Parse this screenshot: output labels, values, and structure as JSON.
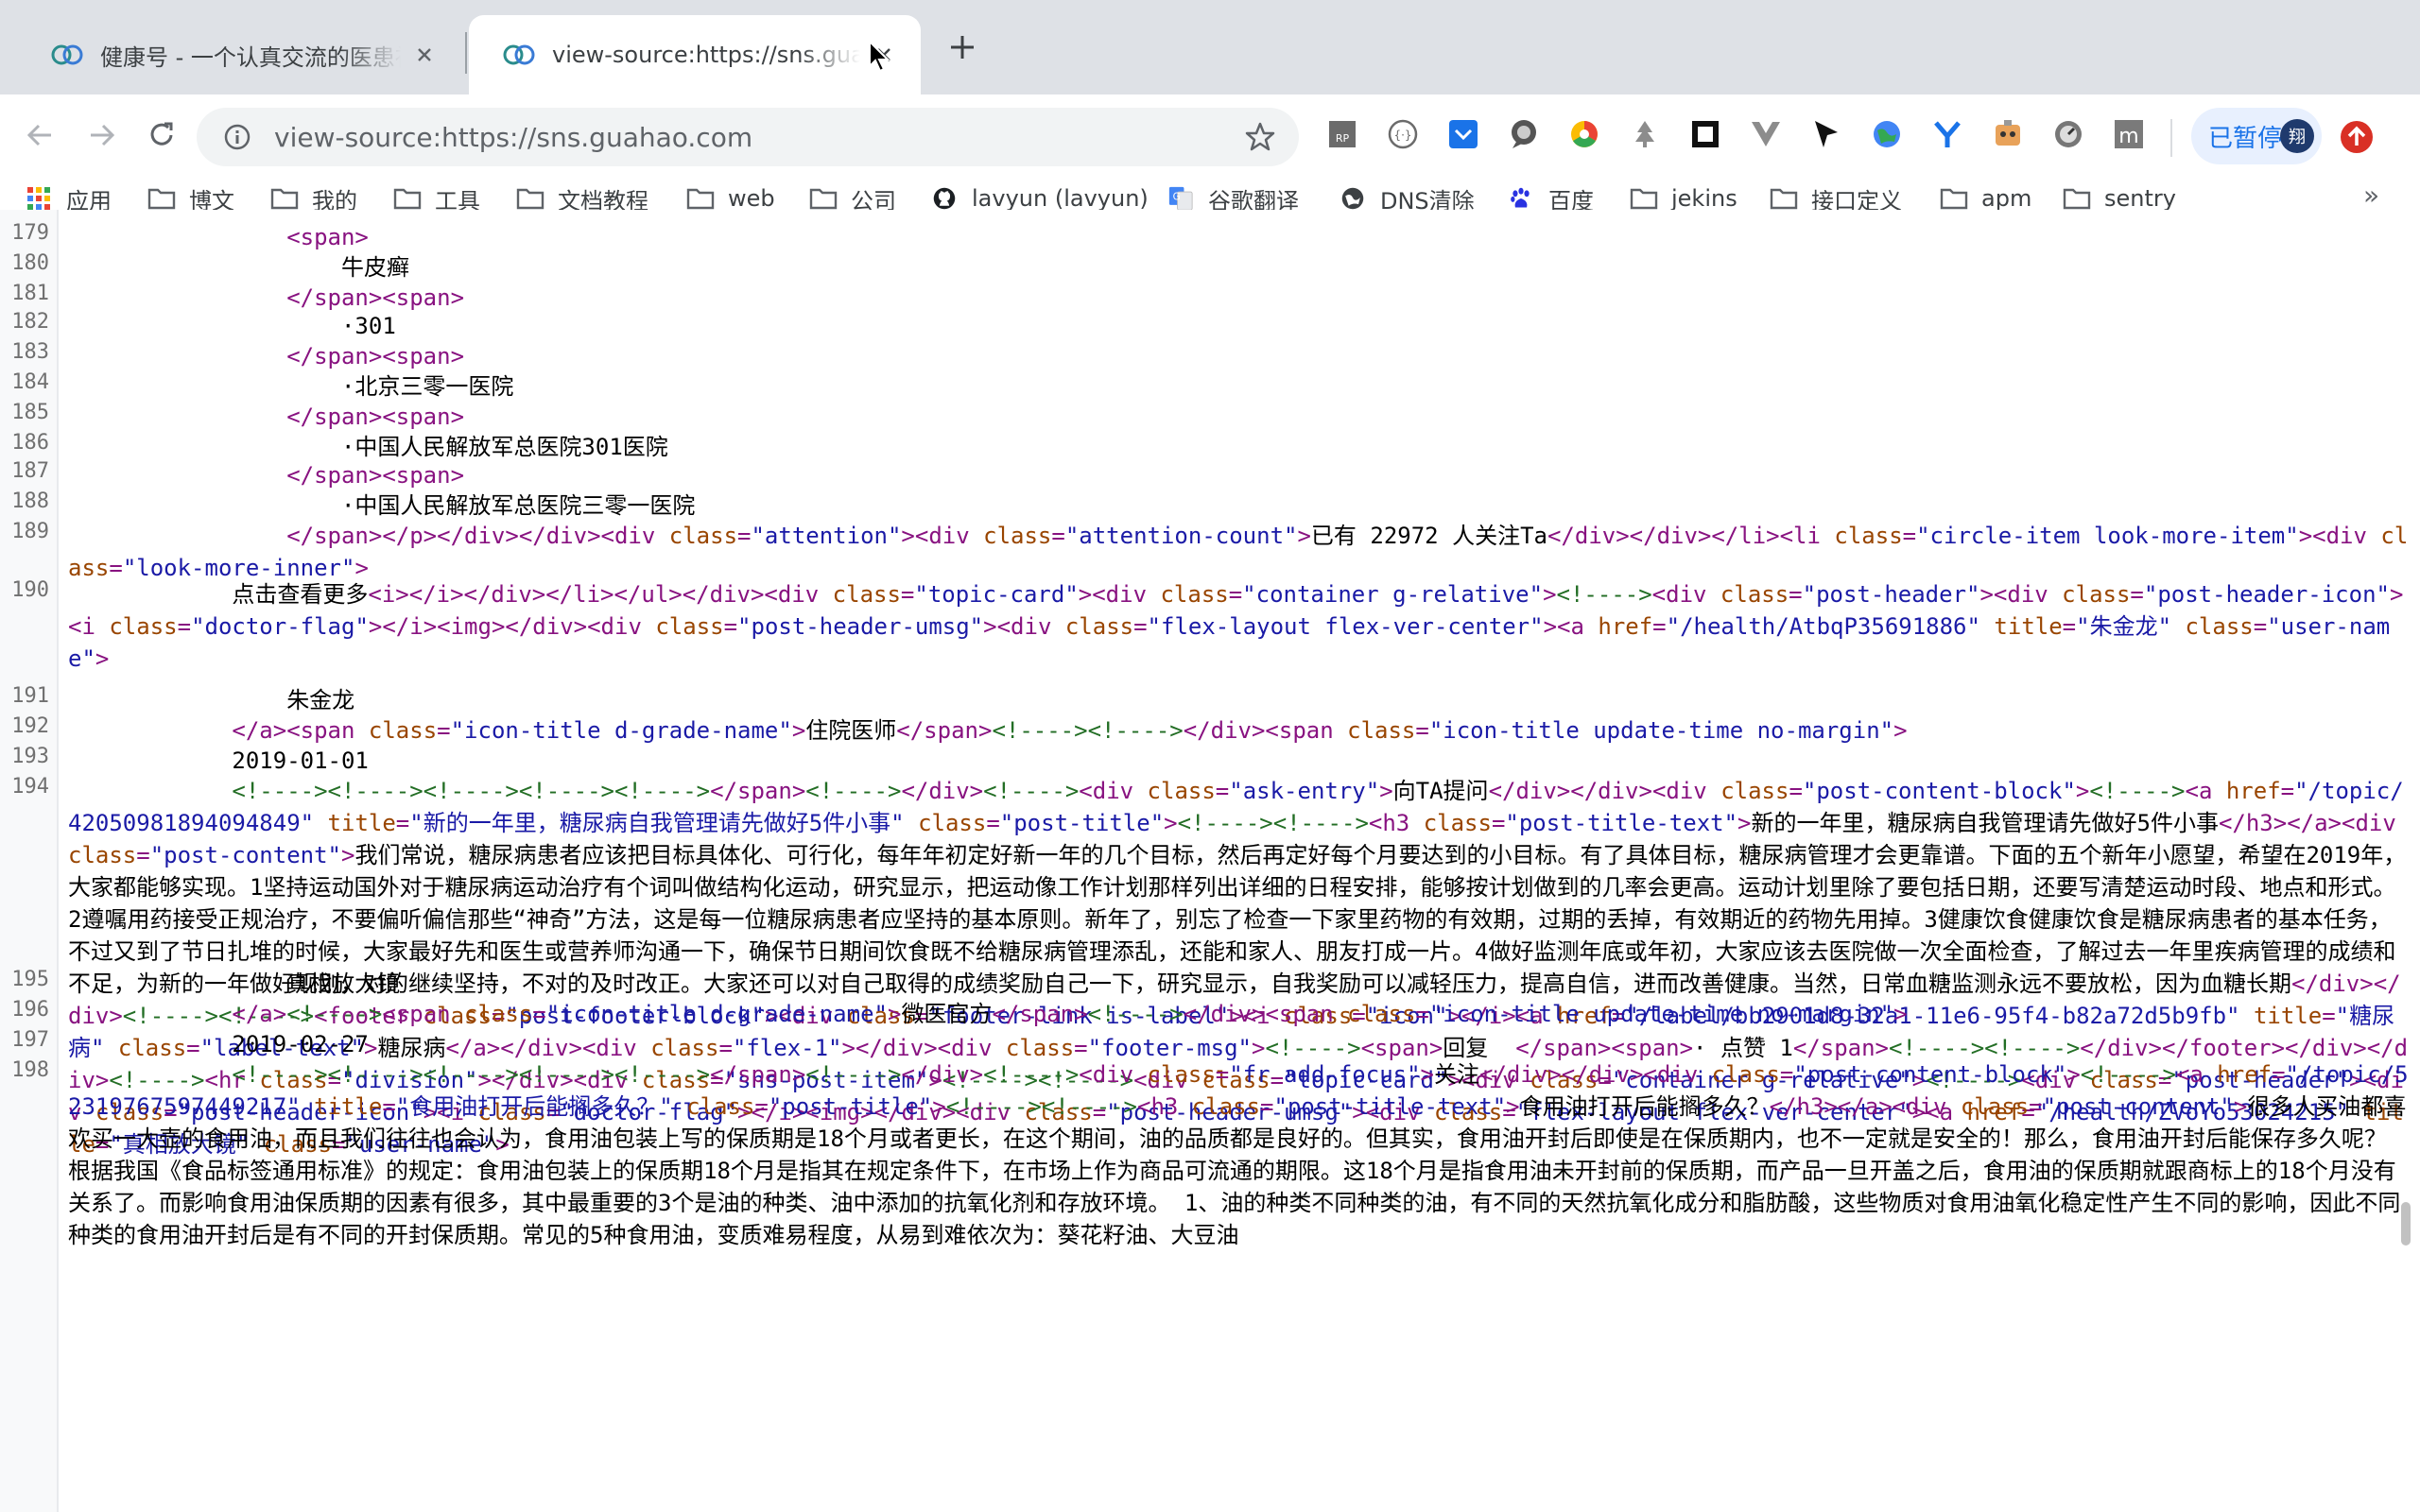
{
  "tabs": [
    {
      "title": "健康号 - 一个认真交流的医患社区"
    },
    {
      "title": "view-source:https://sns.guahao.com"
    }
  ],
  "omnibox": {
    "url": "view-source:https://sns.guahao.com"
  },
  "profile": {
    "status": "已暂停",
    "initial": "翔"
  },
  "bookmarks": [
    {
      "label": "应用",
      "icon": "apps-grid-icon"
    },
    {
      "label": "博文",
      "icon": "folder-icon"
    },
    {
      "label": "我的",
      "icon": "folder-icon"
    },
    {
      "label": "工具",
      "icon": "folder-icon"
    },
    {
      "label": "文档教程",
      "icon": "folder-icon"
    },
    {
      "label": "web",
      "icon": "folder-icon"
    },
    {
      "label": "公司",
      "icon": "folder-icon"
    },
    {
      "label": "lavyun (lavyun)",
      "icon": "github-icon"
    },
    {
      "label": "谷歌翻译",
      "icon": "google-translate-icon"
    },
    {
      "label": "DNS清除",
      "icon": "globe-icon"
    },
    {
      "label": "百度",
      "icon": "baidu-paw-icon"
    },
    {
      "label": "jekins",
      "icon": "folder-icon"
    },
    {
      "label": "接口定义",
      "icon": "folder-icon"
    },
    {
      "label": "apm",
      "icon": "folder-icon"
    },
    {
      "label": "sentry",
      "icon": "folder-icon"
    }
  ],
  "source_lines": [
    {
      "n": "179",
      "html": "                <span class=\"t\">&lt;span&gt;</span>"
    },
    {
      "n": "180",
      "html": "                    牛皮癣"
    },
    {
      "n": "181",
      "html": "                <span class=\"t\">&lt;/span&gt;&lt;span&gt;</span>"
    },
    {
      "n": "182",
      "html": "                    ·301"
    },
    {
      "n": "183",
      "html": "                <span class=\"t\">&lt;/span&gt;&lt;span&gt;</span>"
    },
    {
      "n": "184",
      "html": "                    ·北京三零一医院"
    },
    {
      "n": "185",
      "html": "                <span class=\"t\">&lt;/span&gt;&lt;span&gt;</span>"
    },
    {
      "n": "186",
      "html": "                    ·中国人民解放军总医院301医院"
    },
    {
      "n": "187",
      "html": "                <span class=\"t\">&lt;/span&gt;&lt;span&gt;</span>"
    },
    {
      "n": "188",
      "html": "                    ·中国人民解放军总医院三零一医院"
    },
    {
      "n": "189",
      "html": "                <span class=\"t\">&lt;/span&gt;&lt;/p&gt;&lt;/div&gt;&lt;/div&gt;&lt;div <span class=\"an\">class</span>=<span class=\"av\">\"attention\"</span>&gt;&lt;div <span class=\"an\">class</span>=<span class=\"av\">\"attention-count\"</span>&gt;</span>已有 22972 人关注Ta<span class=\"t\">&lt;/div&gt;&lt;/div&gt;&lt;/li&gt;&lt;li <span class=\"an\">class</span>=<span class=\"av\">\"circle-item look-more-item\"</span>&gt;&lt;div <span class=\"an\">class</span>=<span class=\"av\">\"look-more-inner\"</span>&gt;</span>"
    },
    {
      "n": "190",
      "html": "            点击查看更多<span class=\"t\">&lt;i&gt;&lt;/i&gt;&lt;/div&gt;&lt;/li&gt;&lt;/ul&gt;&lt;/div&gt;&lt;div <span class=\"an\">class</span>=<span class=\"av\">\"topic-card\"</span>&gt;&lt;div <span class=\"an\">class</span>=<span class=\"av\">\"container g-relative\"</span>&gt;</span><span class=\"cm\">&lt;!----&gt;</span><span class=\"t\">&lt;div <span class=\"an\">class</span>=<span class=\"av\">\"post-header\"</span>&gt;&lt;div <span class=\"an\">class</span>=<span class=\"av\">\"post-header-icon\"</span>&gt;&lt;i <span class=\"an\">class</span>=<span class=\"av\">\"doctor-flag\"</span>&gt;&lt;/i&gt;&lt;img&gt;&lt;/div&gt;&lt;div <span class=\"an\">class</span>=<span class=\"av\">\"post-header-umsg\"</span>&gt;&lt;div <span class=\"an\">class</span>=<span class=\"av\">\"flex-layout flex-ver-center\"</span>&gt;&lt;a <span class=\"an\">href</span>=<span class=\"av\">\"/health/AtbqP35691886\"</span> <span class=\"an\">title</span>=<span class=\"av\">\"朱金龙\"</span> <span class=\"an\">class</span>=<span class=\"av\">\"user-name\"</span>&gt;</span>"
    },
    {
      "n": "191",
      "html": "                朱金龙"
    },
    {
      "n": "192",
      "html": "            <span class=\"t\">&lt;/a&gt;&lt;span <span class=\"an\">class</span>=<span class=\"av\">\"icon-title d-grade-name\"</span>&gt;</span>住院医师<span class=\"t\">&lt;/span&gt;</span><span class=\"cm\">&lt;!----&gt;&lt;!----&gt;</span><span class=\"t\">&lt;/div&gt;&lt;span <span class=\"an\">class</span>=<span class=\"av\">\"icon-title update-time no-margin\"</span>&gt;</span>"
    },
    {
      "n": "193",
      "html": "            2019-01-01"
    },
    {
      "n": "194",
      "html": "            <span class=\"cm\">&lt;!----&gt;&lt;!----&gt;&lt;!----&gt;&lt;!----&gt;&lt;!----&gt;</span><span class=\"t\">&lt;/span&gt;</span><span class=\"cm\">&lt;!----&gt;</span><span class=\"t\">&lt;/div&gt;</span><span class=\"cm\">&lt;!----&gt;</span><span class=\"t\">&lt;div <span class=\"an\">class</span>=<span class=\"av\">\"ask-entry\"</span>&gt;</span>向TA提问<span class=\"t\">&lt;/div&gt;&lt;/div&gt;&lt;div <span class=\"an\">class</span>=<span class=\"av\">\"post-content-block\"</span>&gt;</span><span class=\"cm\">&lt;!----&gt;</span><span class=\"t\">&lt;a <span class=\"an\">href</span>=<span class=\"av\">\"/topic/42050981894094849\"</span> <span class=\"an\">title</span>=<span class=\"av\">\"新的一年里，糖尿病自我管理请先做好5件小事\"</span> <span class=\"an\">class</span>=<span class=\"av\">\"post-title\"</span>&gt;</span><span class=\"cm\">&lt;!----&gt;&lt;!----&gt;</span><span class=\"t\">&lt;h3 <span class=\"an\">class</span>=<span class=\"av\">\"post-title-text\"</span>&gt;</span>新的一年里，糖尿病自我管理请先做好5件小事<span class=\"t\">&lt;/h3&gt;&lt;/a&gt;&lt;div <span class=\"an\">class</span>=<span class=\"av\">\"post-content\"</span>&gt;</span>我们常说，糖尿病患者应该把目标具体化、可行化，每年年初定好新一年的几个目标，然后再定好每个月要达到的小目标。有了具体目标，糖尿病管理才会更靠谱。下面的五个新年小愿望，希望在2019年，大家都能够实现。1坚持运动国外对于糖尿病运动治疗有个词叫做结构化运动，研究显示，把运动像工作计划那样列出详细的日程安排，能够按计划做到的几率会更高。运动计划里除了要包括日期，还要写清楚运动时段、地点和形式。2遵嘱用药接受正规治疗，不要偏听偏信那些“神奇”方法，这是每一位糖尿病患者应坚持的基本原则。新年了，别忘了检查一下家里药物的有效期，过期的丢掉，有效期近的药物先用掉。3健康饮食健康饮食是糖尿病患者的基本任务，不过又到了节日扎堆的时候，大家最好先和医生或营养师沟通一下，确保节日期间饮食既不给糖尿病管理添乱，还能和家人、朋友打成一片。4做好监测年底或年初，大家应该去医院做一次全面检查，了解过去一年里疾病管理的成绩和不足，为新的一年做好规划，对的继续坚持，不对的及时改正。大家还可以对自己取得的成绩奖励自己一下，研究显示，自我奖励可以减轻压力，提高自信，进而改善健康。当然，日常血糖监测永远不要放松，因为血糖长期<span class=\"t\">&lt;/div&gt;&lt;/div&gt;</span><span class=\"cm\">&lt;!----&gt;&lt;!----&gt;</span><span class=\"t\">&lt;footer <span class=\"an\">class</span>=<span class=\"av\">\"post-footer-block\"</span>&gt;&lt;div <span class=\"an\">class</span>=<span class=\"av\">\"footer-link is-label\"</span>&gt;&lt;i <span class=\"an\">class</span>=<span class=\"av\">\"icon\"</span>&gt;&lt;/i&gt;&lt;a <span class=\"an\">href</span>=<span class=\"av\">\"/label/bb2901d8-32a1-11e6-95f4-b82a72d5b9fb\"</span> <span class=\"an\">title</span>=<span class=\"av\">\"糖尿病\"</span> <span class=\"an\">class</span>=<span class=\"av\">\"label-text\"</span>&gt;</span>糖尿病<span class=\"t\">&lt;/a&gt;&lt;/div&gt;&lt;div <span class=\"an\">class</span>=<span class=\"av\">\"flex-1\"</span>&gt;&lt;/div&gt;&lt;div <span class=\"an\">class</span>=<span class=\"av\">\"footer-msg\"</span>&gt;</span><span class=\"cm\">&lt;!----&gt;</span><span class=\"t\">&lt;span&gt;</span>回复  <span class=\"t\">&lt;/span&gt;&lt;span&gt;</span>· 点赞 1<span class=\"t\">&lt;/span&gt;</span><span class=\"cm\">&lt;!----&gt;&lt;!----&gt;</span><span class=\"t\">&lt;/div&gt;&lt;/footer&gt;&lt;/div&gt;&lt;/div&gt;</span><span class=\"cm\">&lt;!----&gt;</span><span class=\"t\">&lt;hr <span class=\"an\">class</span>=<span class=\"av\">\"division\"</span>&gt;&lt;/div&gt;&lt;div <span class=\"an\">class</span>=<span class=\"av\">\"sns-post-item\"</span>&gt;</span><span class=\"cm\">&lt;!----&gt;&lt;!----&gt;</span><span class=\"t\">&lt;div <span class=\"an\">class</span>=<span class=\"av\">\"topic-card\"</span>&gt;&lt;div <span class=\"an\">class</span>=<span class=\"av\">\"container g-relative\"</span>&gt;</span><span class=\"cm\">&lt;!----&gt;</span><span class=\"t\">&lt;div <span class=\"an\">class</span>=<span class=\"av\">\"post-header\"</span>&gt;&lt;div <span class=\"an\">class</span>=<span class=\"av\">\"post-header-icon\"</span>&gt;&lt;i <span class=\"an\">class</span>=<span class=\"av\">\"doctor-flag\"</span>&gt;&lt;/i&gt;&lt;img&gt;&lt;/div&gt;&lt;div <span class=\"an\">class</span>=<span class=\"av\">\"post-header-umsg\"</span>&gt;&lt;div <span class=\"an\">class</span>=<span class=\"av\">\"flex-layout flex-ver-center\"</span>&gt;&lt;a <span class=\"an\">href</span>=<span class=\"av\">\"/health/ZVoYo53024215\"</span> <span class=\"an\">title</span>=<span class=\"av\">\"真相放大镜\"</span> <span class=\"an\">class</span>=<span class=\"av\">\"user-name\"</span>&gt;</span>"
    },
    {
      "n": "195",
      "html": "                真相放大镜"
    },
    {
      "n": "196",
      "html": "            <span class=\"t\">&lt;/a&gt;</span><span class=\"cm\">&lt;!----&gt;</span><span class=\"t\">&lt;span <span class=\"an\">class</span>=<span class=\"av\">\"icon-title d-grade-name\"</span>&gt;</span>微医官方<span class=\"t\">&lt;/span&gt;</span><span class=\"cm\">&lt;!----&gt;</span><span class=\"t\">&lt;/div&gt;&lt;span <span class=\"an\">class</span>=<span class=\"av\">\"icon-title update-time no-margin\"</span>&gt;</span>"
    },
    {
      "n": "197",
      "html": "            2019-02-27"
    },
    {
      "n": "198",
      "html": "            <span class=\"cm\">&lt;!----&gt;&lt;!----&gt;&lt;!----&gt;&lt;!----&gt;&lt;!----&gt;</span><span class=\"t\">&lt;/span&gt;</span><span class=\"cm\">&lt;!----&gt;</span><span class=\"t\">&lt;/div&gt;</span><span class=\"cm\">&lt;!----&gt;</span><span class=\"t\">&lt;div <span class=\"an\">class</span>=<span class=\"av\">\"fr add-focus\"</span>&gt;</span>关注<span class=\"t\">&lt;/div&gt;&lt;/div&gt;&lt;div <span class=\"an\">class</span>=<span class=\"av\">\"post-content-block\"</span>&gt;</span><span class=\"cm\">&lt;!----&gt;</span><span class=\"t\">&lt;a <span class=\"an\">href</span>=<span class=\"av\">\"/topic/52319767597449217\"</span> <span class=\"an\">title</span>=<span class=\"av\">\"食用油打开后能搁多久？\"</span> <span class=\"an\">class</span>=<span class=\"av\">\"post-title\"</span>&gt;</span><span class=\"cm\">&lt;!----&gt;&lt;!----&gt;</span><span class=\"t\">&lt;h3 <span class=\"an\">class</span>=<span class=\"av\">\"post-title-text\"</span>&gt;</span>食用油打开后能搁多久？<span class=\"t\">&lt;/h3&gt;&lt;/a&gt;&lt;div <span class=\"an\">class</span>=<span class=\"av\">\"post-content\"</span>&gt;</span>很多人买油都喜欢买一大壶的食用油，而且我们往往也会认为，食用油包装上写的保质期是18个月或者更长，在这个期间，油的品质都是良好的。但其实，食用油开封后即使是在保质期内，也不一定就是安全的！那么，食用油开封后能保存多久呢？ 根据我国《食品标签通用标准》的规定：食用油包装上的保质期18个月是指其在规定条件下，在市场上作为商品可流通的期限。这18个月是指食用油未开封前的保质期，而产品一旦开盖之后，食用油的保质期就跟商标上的18个月没有关系了。而影响食用油保质期的因素有很多，其中最重要的3个是油的种类、油中添加的抗氧化剂和存放环境。 1、油的种类不同种类的油，有不同的天然抗氧化成分和脂肪酸，这些物质对食用油氧化稳定性产生不同的影响，因此不同种类的食用油开封后是有不同的开封保质期。常见的5种食用油，变质难易程度，从易到难依次为：葵花籽油、大豆油"
    }
  ]
}
